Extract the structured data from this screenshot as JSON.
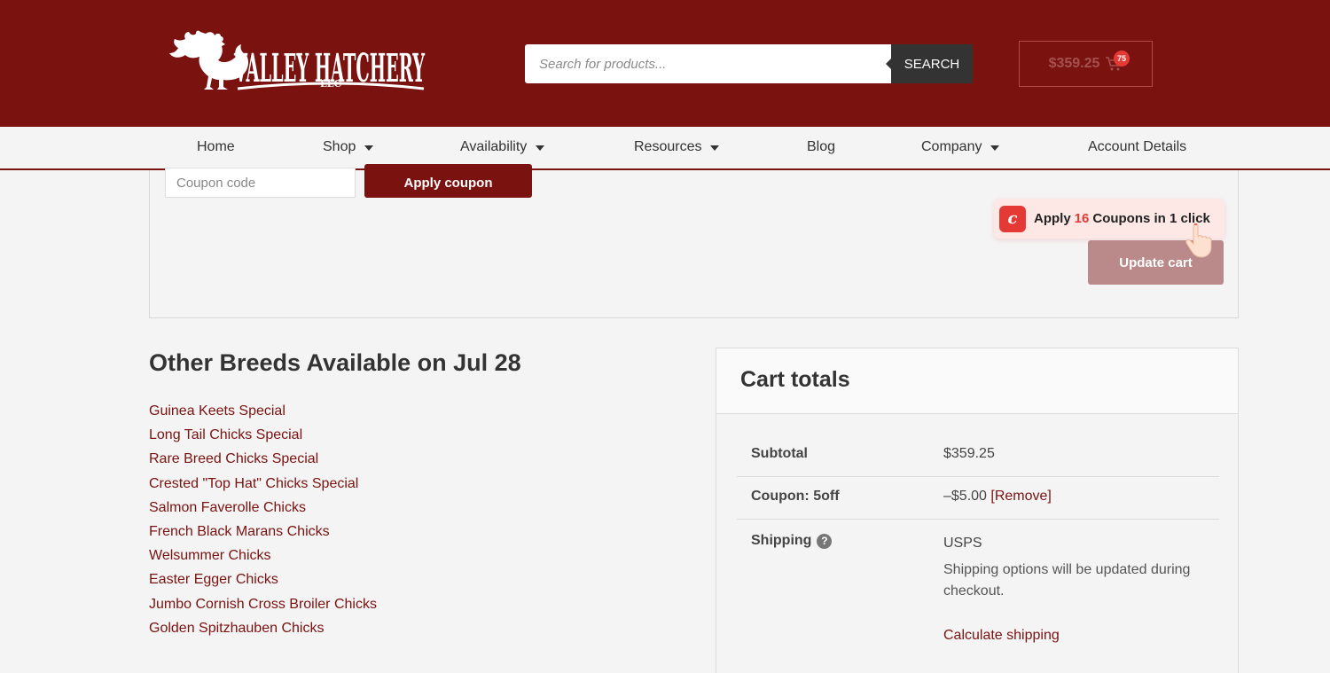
{
  "brand": {
    "name": "VALLEY HATCHERY",
    "suffix": "LLC",
    "color": "#7a1210"
  },
  "header": {
    "search_placeholder": "Search for products...",
    "search_button": "SEARCH",
    "cart_total": "$359.25",
    "cart_count": "75",
    "cart_icon": "cart-icon"
  },
  "nav": {
    "items": [
      {
        "label": "Home",
        "dropdown": false
      },
      {
        "label": "Shop",
        "dropdown": true
      },
      {
        "label": "Availability",
        "dropdown": true
      },
      {
        "label": "Resources",
        "dropdown": true
      },
      {
        "label": "Blog",
        "dropdown": false
      },
      {
        "label": "Company",
        "dropdown": true
      },
      {
        "label": "Account Details",
        "dropdown": false
      }
    ]
  },
  "coupon": {
    "placeholder": "Coupon code",
    "apply_button": "Apply coupon",
    "update_cart": "Update cart"
  },
  "extension": {
    "prefix": "Apply",
    "count": "16",
    "suffix": "Coupons in 1 click",
    "accent": "#e53935"
  },
  "breeds": {
    "title": "Other Breeds Available on Jul 28",
    "items": [
      "Guinea Keets Special",
      "Long Tail Chicks Special",
      "Rare Breed Chicks Special",
      "Crested \"Top Hat\" Chicks Special",
      "Salmon Faverolle Chicks",
      "French Black Marans Chicks",
      "Welsummer Chicks",
      "Easter Egger Chicks",
      "Jumbo Cornish Cross Broiler Chicks",
      "Golden Spitzhauben Chicks"
    ]
  },
  "totals": {
    "title": "Cart totals",
    "subtotal_label": "Subtotal",
    "subtotal_value": "$359.25",
    "coupon_label": "Coupon: 5off",
    "coupon_value": "–$5.00",
    "coupon_remove": "[Remove]",
    "shipping_label": "Shipping",
    "shipping_help": "?",
    "shipping_method": "USPS",
    "shipping_note": "Shipping options will be updated during checkout.",
    "calc_shipping": "Calculate shipping"
  }
}
